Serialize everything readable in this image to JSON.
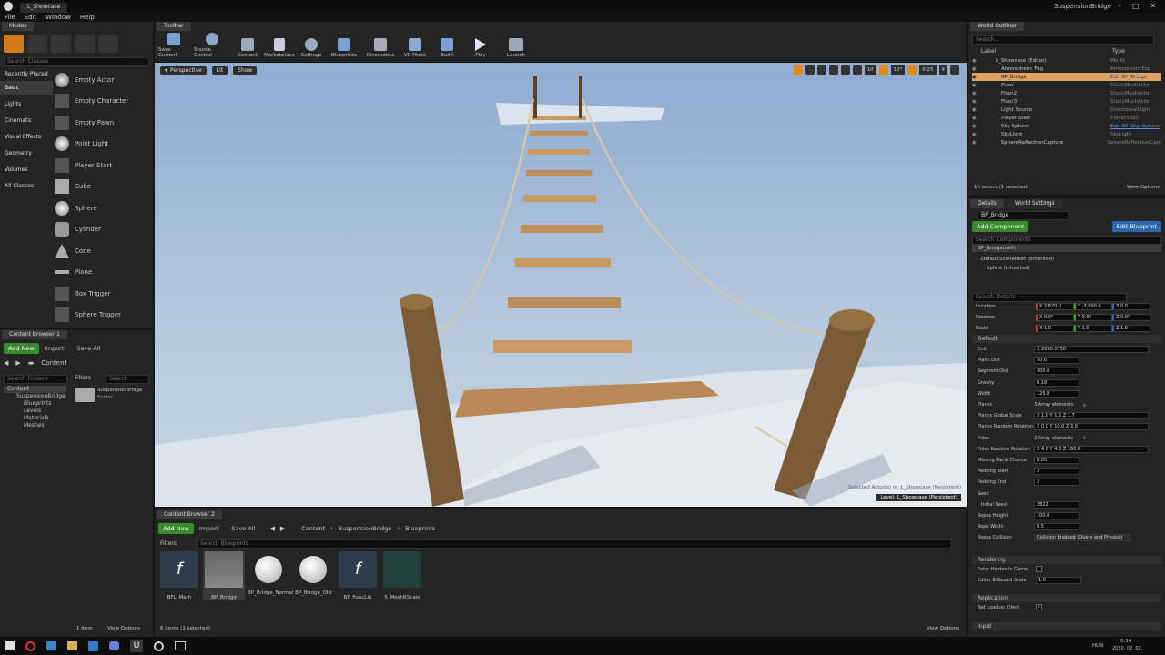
{
  "window": {
    "tab_title": "L_Showcase",
    "project": "SuspensionBridge"
  },
  "menu": [
    "File",
    "Edit",
    "Window",
    "Help"
  ],
  "modes": {
    "tab": "Modes",
    "search_placeholder": "Search Classes",
    "categories": [
      "Recently Placed",
      "Basic",
      "Lights",
      "Cinematic",
      "Visual Effects",
      "Geometry",
      "Volumes",
      "All Classes"
    ],
    "items": [
      "Empty Actor",
      "Empty Character",
      "Empty Pawn",
      "Point Light",
      "Player Start",
      "Cube",
      "Sphere",
      "Cylinder",
      "Cone",
      "Plane",
      "Box Trigger",
      "Sphere Trigger"
    ]
  },
  "toolbar": {
    "tab": "Toolbar",
    "buttons": [
      "Save Current",
      "Source Control",
      "Content",
      "Marketplace",
      "Settings",
      "Blueprints",
      "Cinematics",
      "VR Mode",
      "Build",
      "Play",
      "Launch"
    ]
  },
  "viewport": {
    "perspective": "Perspective",
    "lit": "Lit",
    "show": "Show",
    "grid": "10",
    "angle": "10°",
    "scale": "0.25",
    "cams": "4",
    "selected": "Selected Actor(s) in: L_Showcase (Persistent)",
    "level": "Level: L_Showcase (Persistent)"
  },
  "cb1": {
    "tab": "Content Browser 1",
    "add_new": "Add New",
    "import": "Import",
    "save_all": "Save All",
    "content": "Content",
    "search_folders": "Search Folders",
    "filters": "Filters",
    "search": "Search ",
    "tree": [
      "Content",
      "SuspensionBridge",
      "Blueprints",
      "Levels",
      "Materials",
      "Meshes"
    ],
    "folder_name": "SuspensionBridge",
    "folder_type": "Folder",
    "items_count": "1 item",
    "view_options": "View Options"
  },
  "cb2": {
    "tab": "Content Browser 2",
    "add_new": "Add New",
    "import": "Import",
    "save_all": "Save All",
    "path": [
      "Content",
      "SuspensionBridge",
      "Blueprints"
    ],
    "filters": "Filters",
    "search_placeholder": "Search Blueprints",
    "assets": [
      {
        "name": "BFL_Math"
      },
      {
        "name": "BP_Bridge"
      },
      {
        "name": "BP_Bridge_Normal"
      },
      {
        "name": "BP_Bridge_Old"
      },
      {
        "name": "BP_FuncLib"
      },
      {
        "name": "S_MeshRScale"
      }
    ],
    "status": "6 items (1 selected)",
    "view_options": "View Options"
  },
  "outliner": {
    "tab": "World Outliner",
    "search": "Search...",
    "col_label": "Label",
    "col_type": "Type",
    "rows": [
      {
        "label": "L_Showcase (Editor)",
        "type": "World"
      },
      {
        "label": "Atmospheric Fog",
        "type": "AtmosphericFog"
      },
      {
        "label": "BP_Bridge",
        "type": "Edit BP_Bridge"
      },
      {
        "label": "Floor",
        "type": "StaticMeshActor"
      },
      {
        "label": "Floor2",
        "type": "StaticMeshActor"
      },
      {
        "label": "Floor3",
        "type": "StaticMeshActor"
      },
      {
        "label": "Light Source",
        "type": "DirectionalLight"
      },
      {
        "label": "Player Start",
        "type": "PlayerStart"
      },
      {
        "label": "Sky Sphere",
        "type": "Edit BP_Sky_Sphere"
      },
      {
        "label": "SkyLight",
        "type": "SkyLight"
      },
      {
        "label": "SphereReflectionCapture",
        "type": "SphereReflectionCapt"
      }
    ],
    "status": "10 actors (1 selected)",
    "view_options": "View Options"
  },
  "details": {
    "tab": "Details",
    "tab2": "World Settings",
    "name": "BP_Bridge",
    "add_component": "Add Component",
    "edit_blueprint": "Edit Blueprint",
    "search_components": "Search Components",
    "self": "BP_Bridge(self)",
    "root": "DefaultSceneRoot (Inherited)",
    "spline": "Spline (Inherited)",
    "search_details": "Search Details",
    "transform": [
      {
        "label": "Location",
        "x": "X 2,820.0",
        "y": "Y -3,090.0",
        "z": "Z 0.0"
      },
      {
        "label": "Rotation",
        "x": "X 0.0°",
        "y": "Y 0.0°",
        "z": "Z 0.0°"
      },
      {
        "label": "Scale",
        "x": "X 1.0",
        "y": "Y 1.0",
        "z": "Z 1.0"
      }
    ],
    "default_header": "Default",
    "props": [
      {
        "label": "End",
        "value": "X 2090.0750"
      },
      {
        "label": "Plank Dist",
        "value": "50.0"
      },
      {
        "label": "Segment Dist",
        "value": "300.0"
      },
      {
        "label": "Gravity",
        "value": "0.18"
      },
      {
        "label": "Width",
        "value": "125.0"
      },
      {
        "label": "Planks",
        "value": "3 Array elements"
      },
      {
        "label": "Planks Global Scale",
        "value": "X 1.0  Y 1.5  Z 1.7"
      },
      {
        "label": "Planks Random Rotation",
        "value": "X 0.0  Y 10.0  Z 3.0"
      },
      {
        "label": "Poles",
        "value": "2 Array elements"
      },
      {
        "label": "Poles Random Rotation",
        "value": "X 4.0  Y 4.0  Z 180.0"
      },
      {
        "label": "Missing Plank Chance",
        "value": "0.05"
      },
      {
        "label": "Padding Start",
        "value": "3"
      },
      {
        "label": "Padding End",
        "value": "2"
      },
      {
        "label": "Seed",
        "value": ""
      },
      {
        "label": "Initial Seed",
        "value": "2822"
      },
      {
        "label": "Ropes Height",
        "value": "100.0"
      },
      {
        "label": "Rope Width",
        "value": "0.5"
      },
      {
        "label": "Ropes Collision",
        "value": "Collision Enabled (Query and Physics)"
      }
    ],
    "rendering": "Rendering",
    "actor_hidden": "Actor Hidden In Game",
    "billboard": "Editor Billboard Scale",
    "billboard_value": "1.0",
    "replication": "Replication",
    "net_load": "Net Load on Client",
    "input": "Input"
  },
  "taskbar": {
    "lang": "HUN",
    "time": "0:14",
    "date": "2020. 02. 02."
  },
  "colors": {
    "accent_orange": "#e08a17",
    "green": "#3a8a2e",
    "blue": "#2b67b1",
    "sky": "#a7bfd9"
  }
}
